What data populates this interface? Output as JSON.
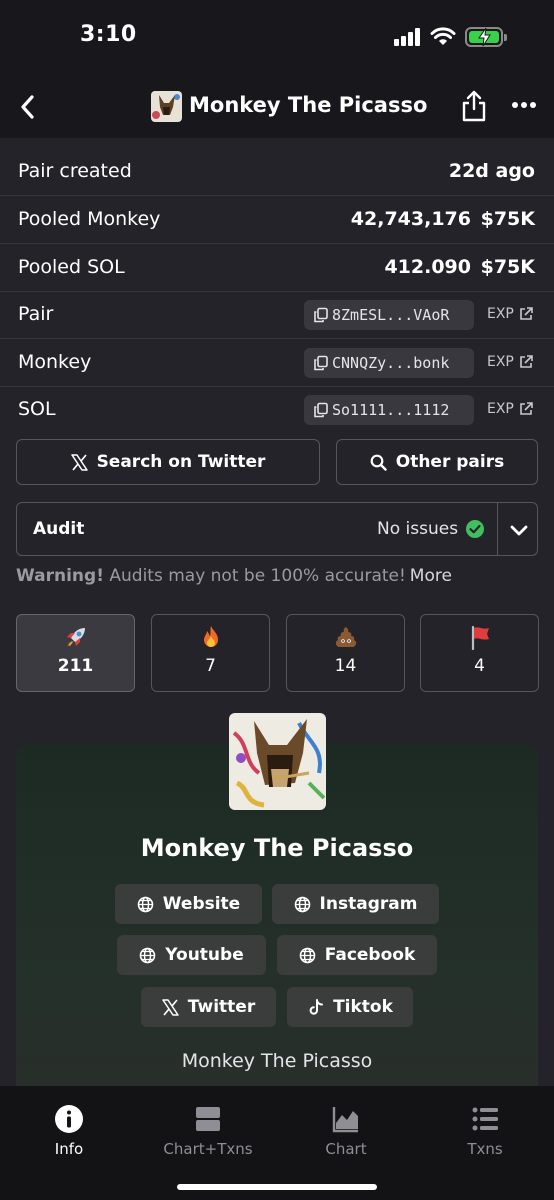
{
  "status_bar": {
    "time": "3:10"
  },
  "nav": {
    "title": "Monkey The Picasso"
  },
  "info_rows": [
    {
      "label": "Pair created",
      "value": "22d ago"
    },
    {
      "label": "Pooled Monkey",
      "amount": "42,743,176",
      "usd": "$75K"
    },
    {
      "label": "Pooled SOL",
      "amount": "412.090",
      "usd": "$75K"
    },
    {
      "label": "Pair",
      "address": "8ZmESL...VAoR",
      "link": "EXP"
    },
    {
      "label": "Monkey",
      "address": "CNNQZy...bonk",
      "link": "EXP"
    },
    {
      "label": "SOL",
      "address": "So1111...1112",
      "link": "EXP"
    }
  ],
  "actions": {
    "search_twitter": "Search on Twitter",
    "other_pairs": "Other pairs"
  },
  "audit": {
    "label": "Audit",
    "status": "No issues",
    "status_color": "#3fbf5f"
  },
  "warning": {
    "bold": "Warning!",
    "text": "Audits may not be 100% accurate!",
    "more": "More"
  },
  "votes": [
    {
      "icon": "rocket-icon",
      "count": "211",
      "active": true
    },
    {
      "icon": "fire-icon",
      "count": "7",
      "active": false
    },
    {
      "icon": "poop-icon",
      "count": "14",
      "active": false
    },
    {
      "icon": "red-flag-icon",
      "count": "4",
      "active": false
    }
  ],
  "token": {
    "name": "Monkey The Picasso",
    "description": "Monkey The Picasso",
    "links": {
      "website": "Website",
      "instagram": "Instagram",
      "youtube": "Youtube",
      "facebook": "Facebook",
      "twitter": "Twitter",
      "tiktok": "Tiktok"
    }
  },
  "tabs": [
    {
      "label": "Info",
      "icon": "info-icon",
      "active": true
    },
    {
      "label": "Chart+Txns",
      "icon": "chart-txns-icon",
      "active": false
    },
    {
      "label": "Chart",
      "icon": "chart-icon",
      "active": false
    },
    {
      "label": "Txns",
      "icon": "list-icon",
      "active": false
    }
  ],
  "colors": {
    "background": "#232329",
    "header": "#18181c",
    "accent_green": "#3fbf5f",
    "battery_green": "#39d04b"
  }
}
